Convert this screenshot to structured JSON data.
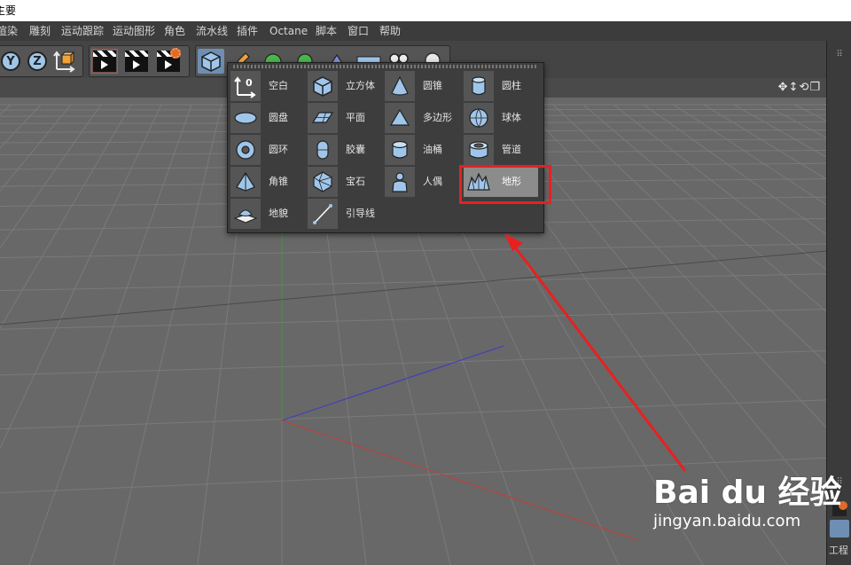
{
  "window": {
    "title": "主要"
  },
  "menu": {
    "items": [
      {
        "label": "渲染"
      },
      {
        "label": "雕刻"
      },
      {
        "label": "运动跟踪"
      },
      {
        "label": "运动图形"
      },
      {
        "label": "角色"
      },
      {
        "label": "流水线"
      },
      {
        "label": "插件"
      },
      {
        "label": "Octane"
      },
      {
        "label": "脚本"
      },
      {
        "label": "窗口"
      },
      {
        "label": "帮助"
      }
    ]
  },
  "toolbar": {
    "axis_y": "Y",
    "axis_z": "Z"
  },
  "popup": {
    "items": [
      {
        "label": "空白",
        "icon": "null-object-icon"
      },
      {
        "label": "立方体",
        "icon": "cube-icon"
      },
      {
        "label": "圆锥",
        "icon": "cone-icon"
      },
      {
        "label": "圆柱",
        "icon": "cylinder-icon"
      },
      {
        "label": "圆盘",
        "icon": "disc-icon"
      },
      {
        "label": "平面",
        "icon": "plane-icon"
      },
      {
        "label": "多边形",
        "icon": "polygon-icon"
      },
      {
        "label": "球体",
        "icon": "sphere-icon"
      },
      {
        "label": "圆环",
        "icon": "torus-icon"
      },
      {
        "label": "胶囊",
        "icon": "capsule-icon"
      },
      {
        "label": "油桶",
        "icon": "oil-tank-icon"
      },
      {
        "label": "管道",
        "icon": "tube-icon"
      },
      {
        "label": "角锥",
        "icon": "pyramid-icon"
      },
      {
        "label": "宝石",
        "icon": "platonic-icon"
      },
      {
        "label": "人偶",
        "icon": "figure-icon"
      },
      {
        "label": "地形",
        "icon": "landscape-icon",
        "selected": true
      },
      {
        "label": "地貌",
        "icon": "relief-icon"
      },
      {
        "label": "引导线",
        "icon": "guide-icon"
      }
    ]
  },
  "rightbar": {
    "label": "工程"
  },
  "watermark": {
    "brand": "Bai du 经验",
    "url": "jingyan.baidu.com"
  },
  "colors": {
    "highlight": "#e82020",
    "icon_blue": "#9fc6ea",
    "axis_x": "#c83c3c",
    "axis_y": "#2f9a2f",
    "axis_z": "#3c4cc8"
  }
}
